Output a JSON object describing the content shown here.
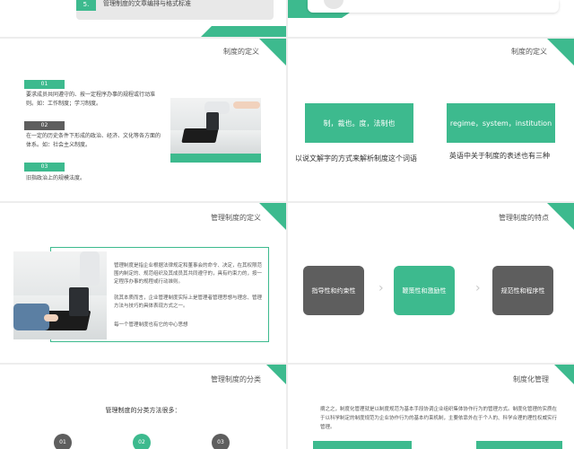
{
  "colors": {
    "accent": "#3dba8e",
    "dark": "#5e5e5e",
    "text": "#444444"
  },
  "slide0": {
    "number": "5.",
    "header_text": "管理制度的文章编排与格式标准"
  },
  "slide1": {
    "title": "制度的定义",
    "items": [
      {
        "num": "01",
        "text": "要求成员共同遵守的、按一定程序办事的规程或行动准则。如：工作制度；学习制度。"
      },
      {
        "num": "02",
        "text": "在一定的历史条件下形成的政治、经济、文化等各方面的体系。如：社会主义制度。"
      },
      {
        "num": "03",
        "text": "旧指政治上的规模法度。"
      }
    ]
  },
  "slide2": {
    "title": "制度的定义",
    "box_left": "制，裁也。度，法制也",
    "box_right": "regime，system，institution",
    "caption_left": "以说文解字的方式来解析制度这个词语",
    "caption_right": "英语中关于制度的表述也有三种"
  },
  "slide3": {
    "title": "管理制度的定义",
    "para1": "管理制度是指企业根据法律规定和董事会的命令、决定，在其权限范围内制定的、规范组织及其成员其共同遵守的，具有约束力的，按一定程序办事的规程或行动准则。",
    "para2": "就其本质而言，企业管理制度实际上是管理者管理思想与理念、管理方法与技巧的具体表现方式之一。",
    "para3": "每一个管理制度也有它的中心思想"
  },
  "slide4": {
    "title": "管理制度的特点",
    "features": [
      "指导性和约束性",
      "鞭策性和激励性",
      "规范性和程序性"
    ],
    "chevron": "›"
  },
  "slide5": {
    "title": "管理制度的分类",
    "intro": "管理制度的分类方法很多：",
    "nums": [
      "01",
      "02",
      "03"
    ]
  },
  "slide6": {
    "title": "制度化管理",
    "para": "摘之之，制度化管理就是以制度规范为基本手段协调企业组织集体协作行为的管理方式。制度化管理的实质在于以科学制定的制度规范为企业协作行为的基本约束机制，主要依靠外在于个人的、科学合理的理性权威实行管理。"
  }
}
